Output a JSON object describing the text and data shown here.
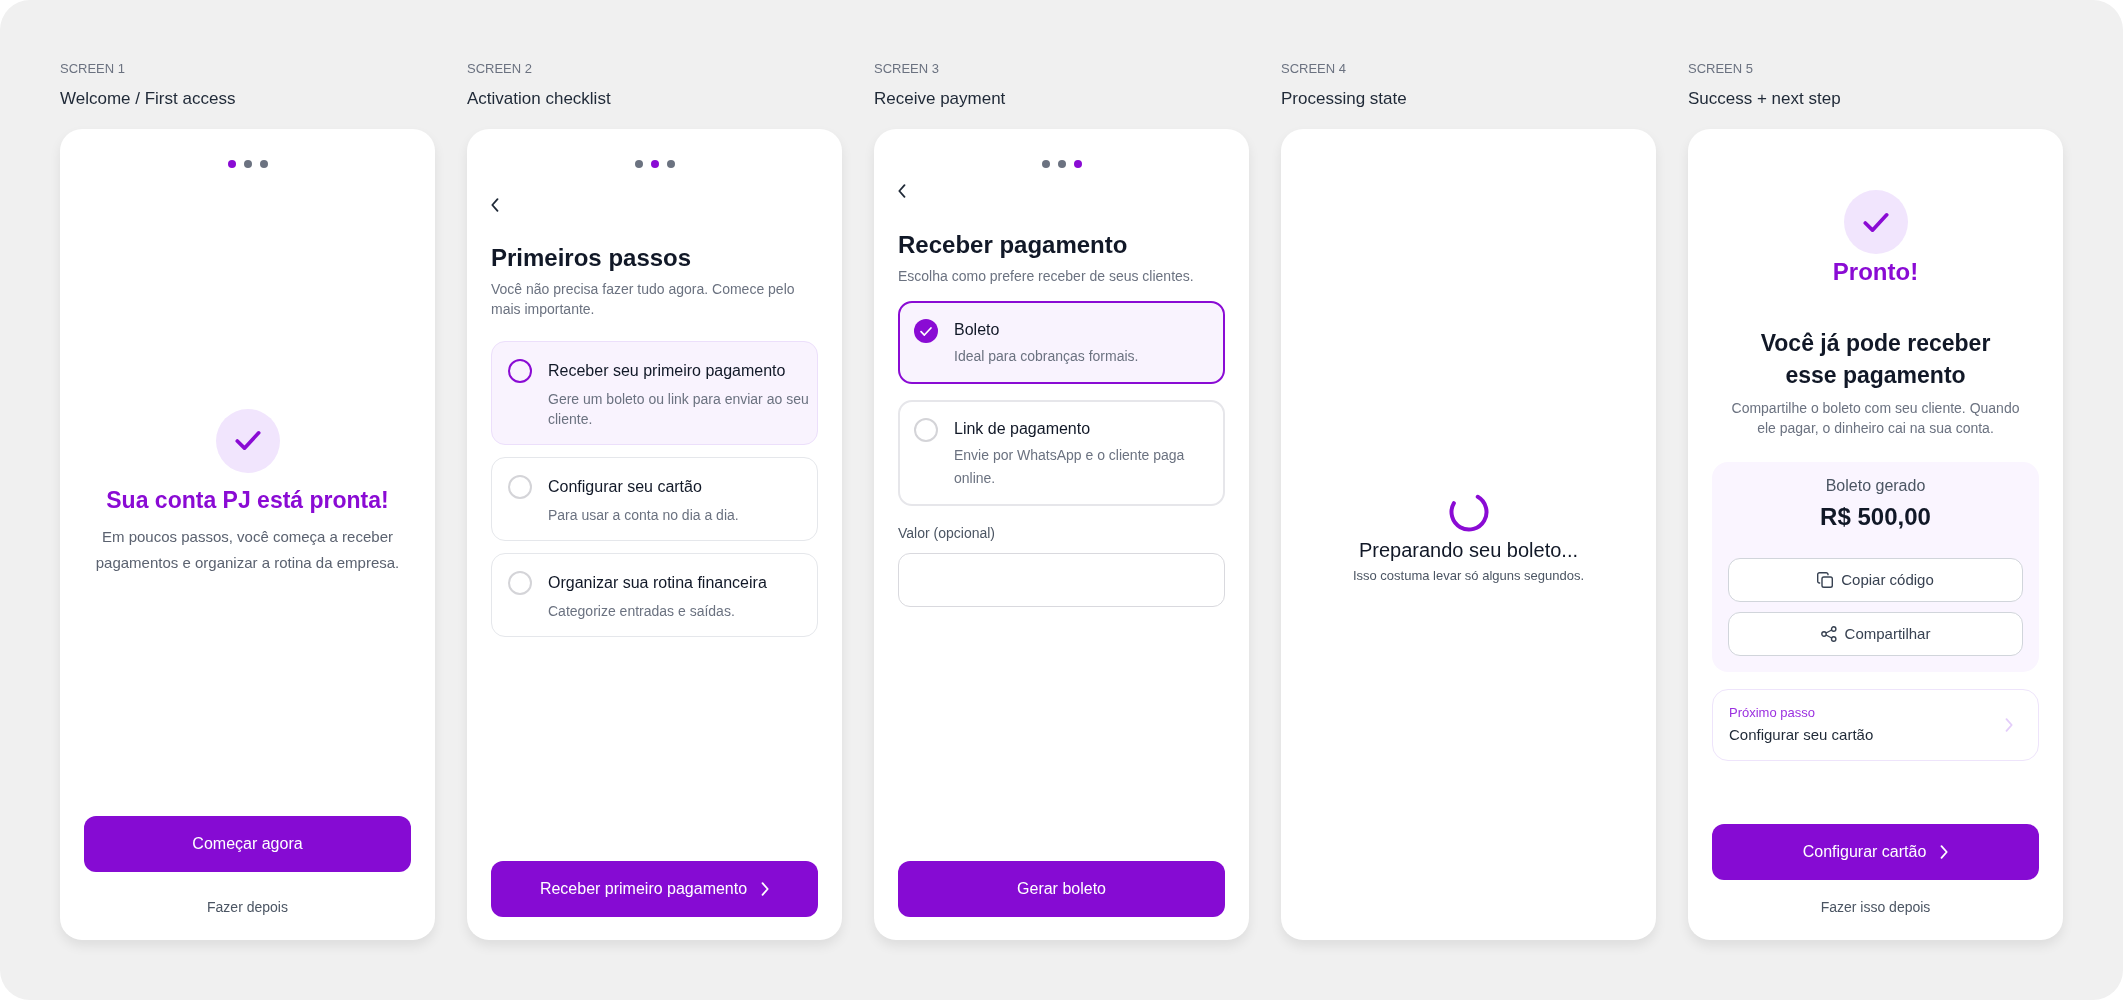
{
  "screens": [
    {
      "kind": "welcome",
      "screen_label": "SCREEN 1",
      "screen_title": "Welcome / First access",
      "dots": [
        {
          "selected": true
        },
        {
          "selected": false
        },
        {
          "selected": false
        }
      ],
      "heading": "Sua conta PJ está pronta!",
      "body": "Em poucos passos, você começa a receber pagamentos e organizar a rotina da empresa.",
      "primary_button": "Começar agora",
      "secondary_link": "Fazer depois"
    },
    {
      "kind": "checklist",
      "screen_label": "SCREEN 2",
      "screen_title": "Activation checklist",
      "dots": [
        {
          "selected": false
        },
        {
          "selected": true
        },
        {
          "selected": false
        }
      ],
      "heading": "Primeiros passos",
      "subtitle": "Você não precisa fazer tudo agora. Comece pelo mais importante.",
      "items": [
        {
          "title": "Receber seu primeiro pagamento",
          "description": "Gere um boleto ou link para enviar ao seu cliente.",
          "selected": true
        },
        {
          "title": "Configurar seu cartão",
          "description": "Para usar a conta no dia a dia.",
          "selected": false
        },
        {
          "title": "Organizar sua rotina financeira",
          "description": "Categorize entradas e saídas.",
          "selected": false
        }
      ],
      "primary_button": "Receber primeiro pagamento"
    },
    {
      "kind": "payment_form",
      "screen_label": "SCREEN 3",
      "screen_title": "Receive payment",
      "dots": [
        {
          "selected": false
        },
        {
          "selected": false
        },
        {
          "selected": true
        }
      ],
      "heading": "Receber pagamento",
      "subtitle": "Escolha como prefere receber de seus clientes.",
      "options": [
        {
          "title": "Boleto",
          "description": "Ideal para cobranças formais.",
          "selected": true
        },
        {
          "title": "Link de pagamento",
          "description": "Envie por WhatsApp e o cliente paga online.",
          "selected": false
        }
      ],
      "field": {
        "label": "Valor (opcional)"
      },
      "primary_button": "Gerar boleto"
    },
    {
      "kind": "processing",
      "screen_label": "SCREEN 4",
      "screen_title": "Processing state",
      "message": "Preparando seu boleto...",
      "hint": "Isso costuma levar só alguns segundos."
    },
    {
      "kind": "success",
      "screen_label": "SCREEN 5",
      "screen_title": "Success + next step",
      "status": "Pronto!",
      "heading": "Você já pode receber esse pagamento",
      "body": "Compartilhe o boleto com seu cliente. Quando ele pagar, o dinheiro cai na sua conta.",
      "boleto": {
        "caption": "Boleto gerado",
        "amount": "R$ 500,00",
        "actions": [
          {
            "kind": "copy",
            "label": "Copiar código"
          },
          {
            "kind": "share",
            "label": "Compartilhar"
          }
        ]
      },
      "next_step": {
        "caption": "Próximo passo",
        "title": "Configurar seu cartão"
      },
      "primary_button": "Configurar cartão",
      "secondary_link": "Fazer isso depois"
    }
  ]
}
